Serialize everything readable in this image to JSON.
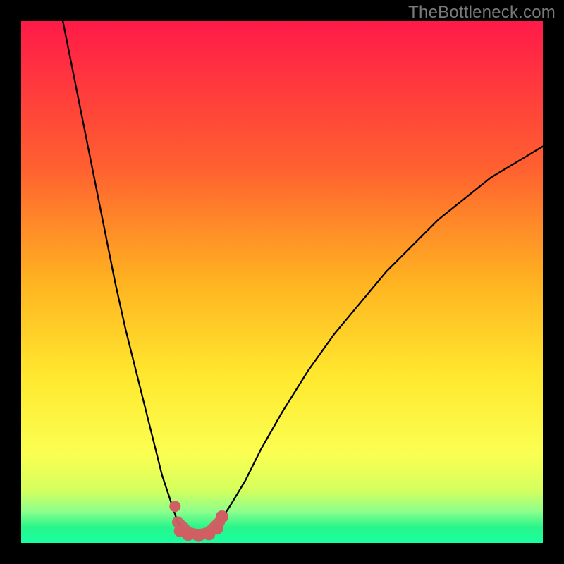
{
  "watermark": "TheBottleneck.com",
  "colors": {
    "frame": "#000000",
    "watermark": "#7a7a7a",
    "curve": "#000000",
    "marker": "#cf5f63",
    "gradient_top": "#ff1a48",
    "gradient_mid_upper": "#ff8d2a",
    "gradient_mid": "#ffe82e",
    "gradient_lower": "#f7ff5a",
    "gradient_green1": "#73ff73",
    "gradient_green2": "#00e676",
    "gradient_bottom": "#18ffa0"
  },
  "chart_data": {
    "type": "line",
    "title": "",
    "xlabel": "",
    "ylabel": "",
    "xlim": [
      0,
      100
    ],
    "ylim": [
      0,
      100
    ],
    "series": [
      {
        "name": "left-branch",
        "x": [
          8,
          10,
          12,
          14,
          16,
          18,
          20,
          22,
          24,
          26,
          27,
          28,
          29,
          30
        ],
        "y": [
          100,
          90,
          80,
          70,
          60,
          50,
          41,
          33,
          25,
          17,
          13,
          10,
          7,
          4
        ]
      },
      {
        "name": "right-branch",
        "x": [
          38,
          40,
          43,
          46,
          50,
          55,
          60,
          65,
          70,
          75,
          80,
          85,
          90,
          95,
          100
        ],
        "y": [
          4,
          7,
          12,
          18,
          25,
          33,
          40,
          46,
          52,
          57,
          62,
          66,
          70,
          73,
          76
        ]
      },
      {
        "name": "valley",
        "x": [
          30,
          32,
          34,
          36,
          38
        ],
        "y": [
          4,
          2,
          1.5,
          2,
          4
        ]
      }
    ],
    "markers": {
      "name": "highlighted-points",
      "points": [
        {
          "x": 29.5,
          "y": 7
        },
        {
          "x": 30.5,
          "y": 2.3
        },
        {
          "x": 32,
          "y": 1.6
        },
        {
          "x": 34,
          "y": 1.4
        },
        {
          "x": 36,
          "y": 1.7
        },
        {
          "x": 37.5,
          "y": 2.8
        },
        {
          "x": 38.5,
          "y": 5
        }
      ]
    }
  }
}
